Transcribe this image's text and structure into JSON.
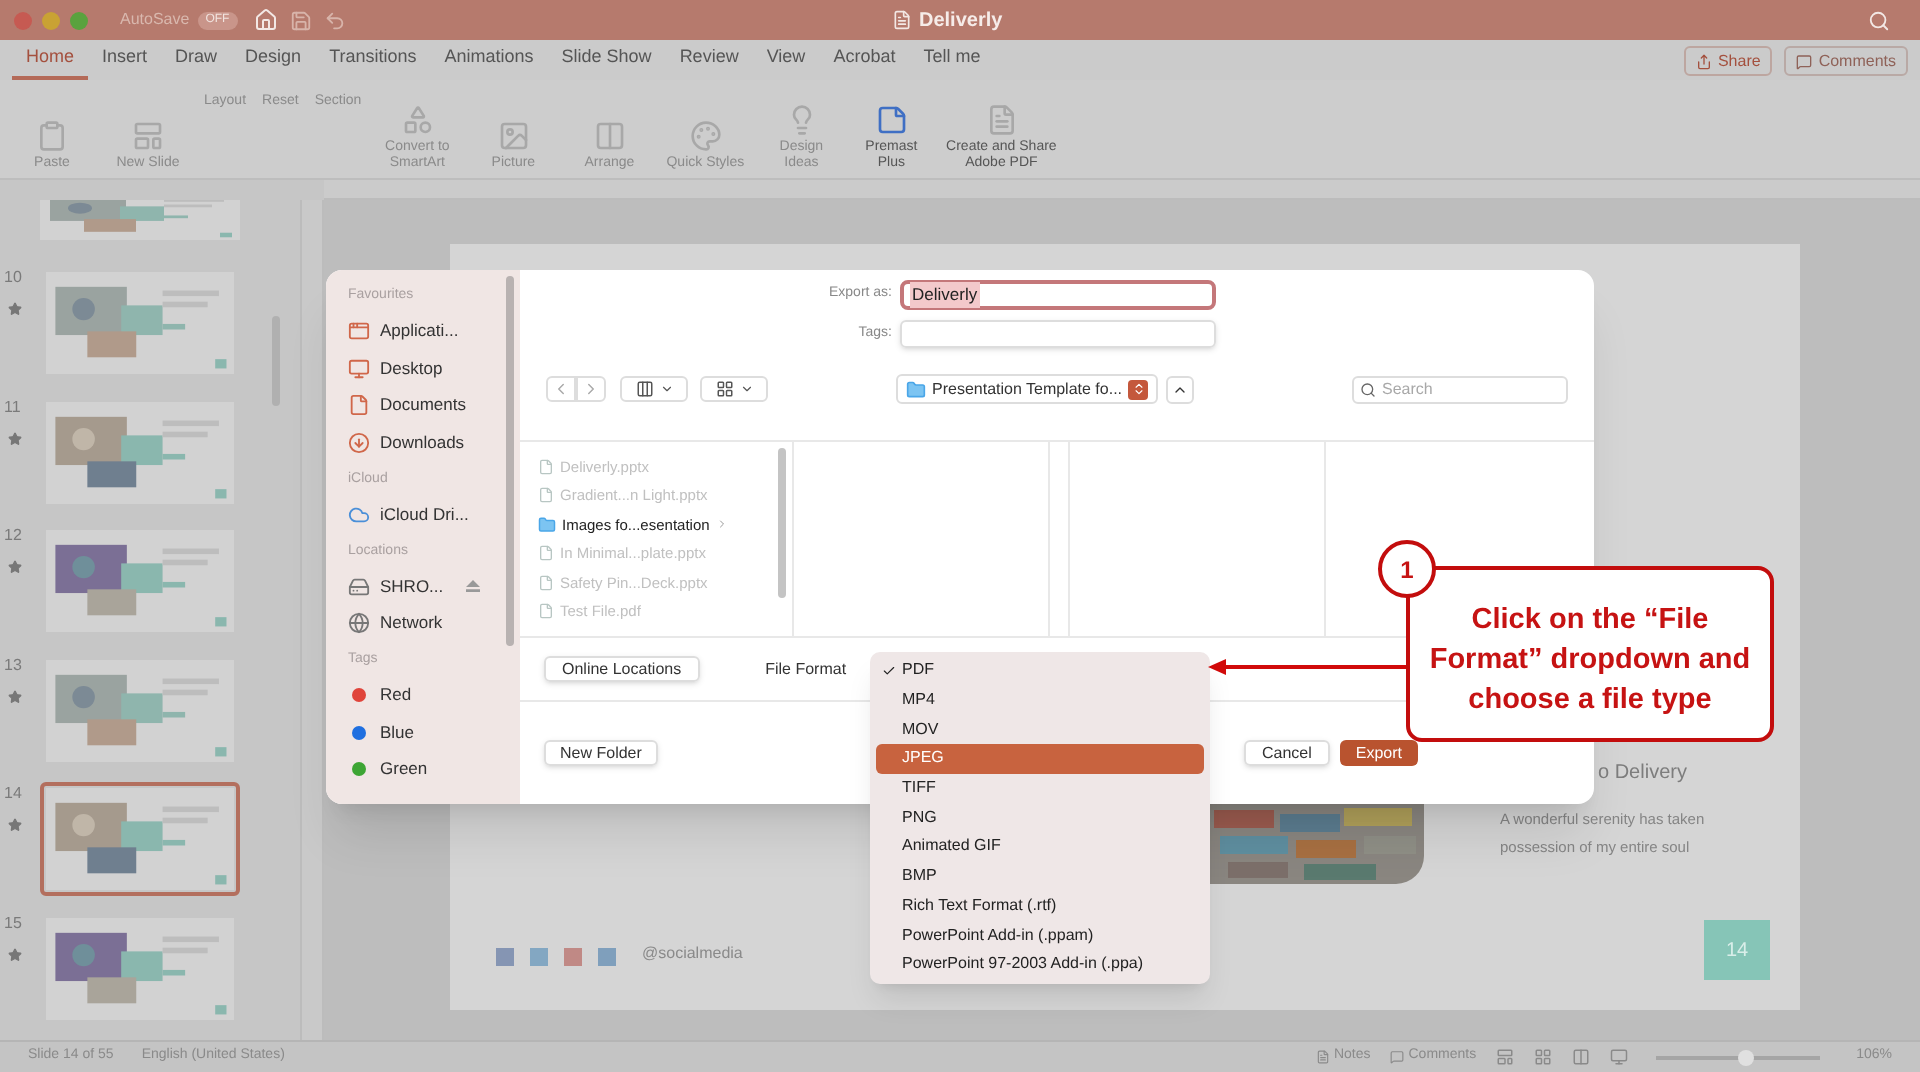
{
  "window": {
    "title": "Deliverly",
    "autosave_label": "AutoSave",
    "autosave_state": "OFF"
  },
  "ribbon_tabs": [
    {
      "label": "Home",
      "selected": true
    },
    {
      "label": "Insert",
      "selected": false
    },
    {
      "label": "Draw",
      "selected": false
    },
    {
      "label": "Design",
      "selected": false
    },
    {
      "label": "Transitions",
      "selected": false
    },
    {
      "label": "Animations",
      "selected": false
    },
    {
      "label": "Slide Show",
      "selected": false
    },
    {
      "label": "Review",
      "selected": false
    },
    {
      "label": "View",
      "selected": false
    },
    {
      "label": "Acrobat",
      "selected": false
    },
    {
      "label": "Tell me",
      "selected": false
    }
  ],
  "share_button": "Share",
  "comments_button": "Comments",
  "ribbon_commands": [
    {
      "label": "Paste",
      "kind": "large"
    },
    {
      "label": "New Slide",
      "kind": "large"
    },
    {
      "label": "Layout",
      "kind": "small"
    },
    {
      "label": "Reset",
      "kind": "small"
    },
    {
      "label": "Section",
      "kind": "small"
    },
    {
      "label": "Convert to SmartArt",
      "kind": "large"
    },
    {
      "label": "Picture",
      "kind": "large"
    },
    {
      "label": "Arrange",
      "kind": "large"
    },
    {
      "label": "Quick Styles",
      "kind": "large"
    },
    {
      "label": "Design Ideas",
      "kind": "large"
    },
    {
      "label": "Premast Plus",
      "kind": "large"
    },
    {
      "label": "Create and Share Adobe PDF",
      "kind": "large"
    }
  ],
  "slides": [
    {
      "number": "10",
      "selected": false
    },
    {
      "number": "11",
      "selected": false
    },
    {
      "number": "12",
      "selected": false
    },
    {
      "number": "13",
      "selected": false
    },
    {
      "number": "14",
      "selected": true
    },
    {
      "number": "15",
      "selected": false
    }
  ],
  "slide": {
    "heading": "o Delivery",
    "body": "A wonderful serenity has taken possession of my entire soul",
    "handle": "@socialmedia",
    "page_number": "14"
  },
  "export_dialog": {
    "export_as_label": "Export as:",
    "export_as_value": "Deliverly",
    "tags_label": "Tags:",
    "location": "Presentation Template fo...",
    "search_placeholder": "Search",
    "sidebar": [
      {
        "heading": "Favourites",
        "items": [
          {
            "label": "Applicati...",
            "kind": "apps"
          },
          {
            "label": "Desktop",
            "kind": "desktop"
          },
          {
            "label": "Documents",
            "kind": "document"
          },
          {
            "label": "Downloads",
            "kind": "download"
          }
        ]
      },
      {
        "heading": "iCloud",
        "items": [
          {
            "label": "iCloud Dri...",
            "kind": "cloud"
          }
        ]
      },
      {
        "heading": "Locations",
        "items": [
          {
            "label": "SHRO...",
            "kind": "drive"
          },
          {
            "label": "Network",
            "kind": "network"
          }
        ]
      },
      {
        "heading": "Tags",
        "items": [
          {
            "label": "Red",
            "kind": "tag",
            "color": "#e0443a"
          },
          {
            "label": "Blue",
            "kind": "tag",
            "color": "#1f6fe0"
          },
          {
            "label": "Green",
            "kind": "tag",
            "color": "#3da534"
          }
        ]
      }
    ],
    "files": [
      {
        "name": "Deliverly.pptx",
        "kind": "file",
        "disabled": true
      },
      {
        "name": "Gradient...n Light.pptx",
        "kind": "file",
        "disabled": true
      },
      {
        "name": "Images fo...esentation",
        "kind": "folder",
        "disabled": false
      },
      {
        "name": "In Minimal...plate.pptx",
        "kind": "file",
        "disabled": true
      },
      {
        "name": "Safety Pin...Deck.pptx",
        "kind": "file",
        "disabled": true
      },
      {
        "name": "Test File.pdf",
        "kind": "file",
        "disabled": true
      }
    ],
    "online_locations_button": "Online Locations",
    "file_format_label": "File Format",
    "new_folder_button": "New Folder",
    "cancel_button": "Cancel",
    "export_button": "Export"
  },
  "format_menu": [
    {
      "label": "PDF",
      "checked": true,
      "selected": false
    },
    {
      "label": "MP4",
      "checked": false,
      "selected": false
    },
    {
      "label": "MOV",
      "checked": false,
      "selected": false
    },
    {
      "label": "JPEG",
      "checked": false,
      "selected": true
    },
    {
      "label": "TIFF",
      "checked": false,
      "selected": false
    },
    {
      "label": "PNG",
      "checked": false,
      "selected": false
    },
    {
      "label": "Animated GIF",
      "checked": false,
      "selected": false
    },
    {
      "label": "BMP",
      "checked": false,
      "selected": false
    },
    {
      "label": "Rich Text Format (.rtf)",
      "checked": false,
      "selected": false
    },
    {
      "label": "PowerPoint Add-in (.ppam)",
      "checked": false,
      "selected": false
    },
    {
      "label": "PowerPoint 97-2003 Add-in (.ppa)",
      "checked": false,
      "selected": false
    }
  ],
  "callout": {
    "step": "1",
    "text": "Click on the “File Format” dropdown and choose a file type"
  },
  "status_bar": {
    "slide_info": "Slide 14 of 55",
    "language": "English (United States)",
    "notes": "Notes",
    "comments": "Comments",
    "zoom": "106%",
    "zoom_slider": {
      "level": 0.55
    }
  }
}
